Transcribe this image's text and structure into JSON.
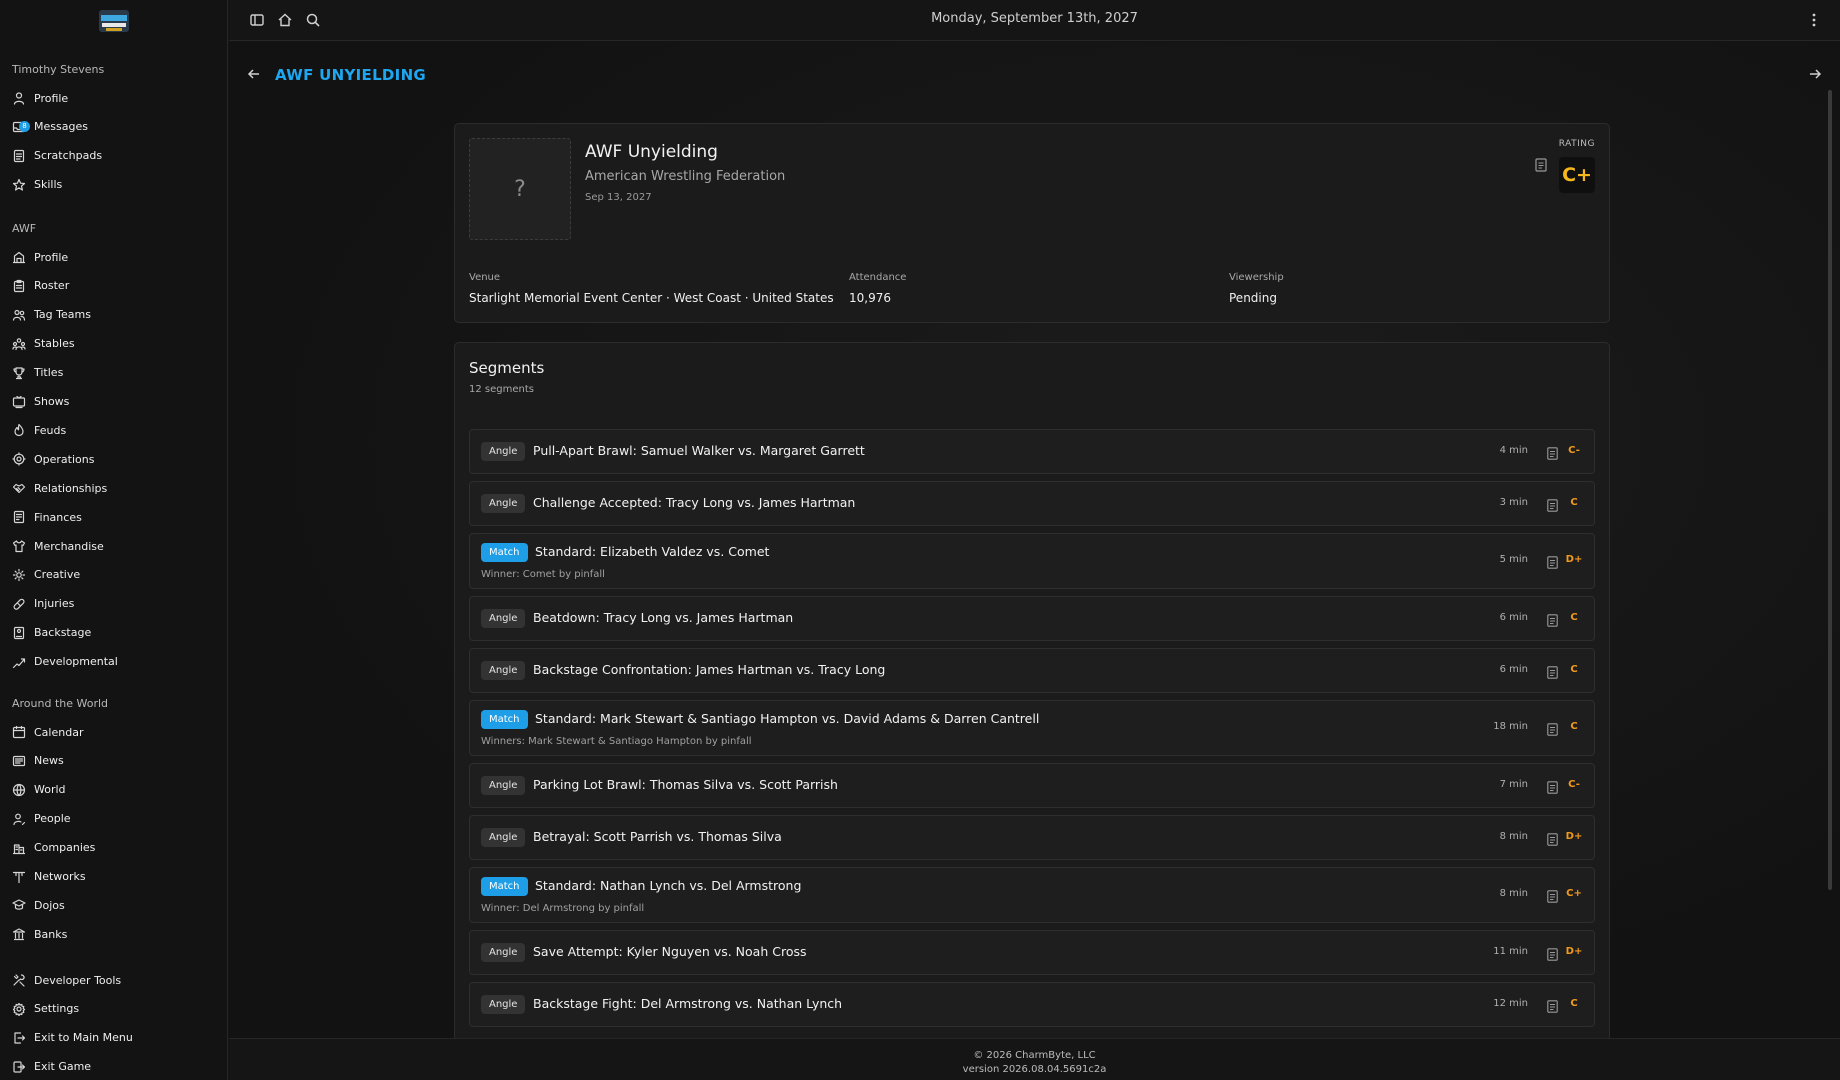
{
  "topbar": {
    "date": "Monday, September 13th, 2027"
  },
  "sidebar": {
    "user_section": "Timothy Stevens",
    "user_items": [
      {
        "label": "Profile",
        "icon": "user-icon"
      },
      {
        "label": "Messages",
        "icon": "inbox-icon",
        "badge": "8"
      },
      {
        "label": "Scratchpads",
        "icon": "notepad-icon"
      },
      {
        "label": "Skills",
        "icon": "star-icon"
      }
    ],
    "company_section": "AWF",
    "company_items": [
      {
        "label": "Profile",
        "icon": "building-icon"
      },
      {
        "label": "Roster",
        "icon": "clipboard-icon"
      },
      {
        "label": "Tag Teams",
        "icon": "users-icon"
      },
      {
        "label": "Stables",
        "icon": "group-icon"
      },
      {
        "label": "Titles",
        "icon": "trophy-icon"
      },
      {
        "label": "Shows",
        "icon": "tv-icon"
      },
      {
        "label": "Feuds",
        "icon": "flame-icon"
      },
      {
        "label": "Operations",
        "icon": "cog-icon"
      },
      {
        "label": "Relationships",
        "icon": "handshake-icon"
      },
      {
        "label": "Finances",
        "icon": "wallet-icon"
      },
      {
        "label": "Merchandise",
        "icon": "shirt-icon"
      },
      {
        "label": "Creative",
        "icon": "bulb-icon"
      },
      {
        "label": "Injuries",
        "icon": "bandage-icon"
      },
      {
        "label": "Backstage",
        "icon": "door-icon"
      },
      {
        "label": "Developmental",
        "icon": "growth-icon"
      }
    ],
    "world_section": "Around the World",
    "world_items": [
      {
        "label": "Calendar",
        "icon": "calendar-icon"
      },
      {
        "label": "News",
        "icon": "newspaper-icon"
      },
      {
        "label": "World",
        "icon": "globe-icon"
      },
      {
        "label": "People",
        "icon": "person-search-icon"
      },
      {
        "label": "Companies",
        "icon": "company-icon"
      },
      {
        "label": "Networks",
        "icon": "antenna-icon"
      },
      {
        "label": "Dojos",
        "icon": "school-icon"
      },
      {
        "label": "Banks",
        "icon": "bank-icon"
      }
    ],
    "bottom_items": [
      {
        "label": "Developer Tools",
        "icon": "tools-icon"
      },
      {
        "label": "Settings",
        "icon": "gear-icon"
      },
      {
        "label": "Exit to Main Menu",
        "icon": "exit-icon"
      },
      {
        "label": "Exit Game",
        "icon": "logout-icon"
      }
    ]
  },
  "page": {
    "title": "AWF UNYIELDING"
  },
  "show": {
    "poster_placeholder": "?",
    "name": "AWF Unyielding",
    "promotion": "American Wrestling Federation",
    "date": "Sep 13, 2027",
    "rating_label": "RATING",
    "rating": "C+",
    "venue_label": "Venue",
    "venue": "Starlight Memorial Event Center · West Coast · United States",
    "attendance_label": "Attendance",
    "attendance": "10,976",
    "viewership_label": "Viewership",
    "viewership": "Pending"
  },
  "segments": {
    "title": "Segments",
    "count": "12 segments",
    "items": [
      {
        "type": "Angle",
        "name": "Pull-Apart Brawl: Samuel Walker vs. Margaret Garrett",
        "duration": "4 min",
        "grade": "C-"
      },
      {
        "type": "Angle",
        "name": "Challenge Accepted: Tracy Long vs. James Hartman",
        "duration": "3 min",
        "grade": "C"
      },
      {
        "type": "Match",
        "name": "Standard: Elizabeth Valdez vs. Comet",
        "result": "Winner: Comet by pinfall",
        "duration": "5 min",
        "grade": "D+"
      },
      {
        "type": "Angle",
        "name": "Beatdown: Tracy Long vs. James Hartman",
        "duration": "6 min",
        "grade": "C"
      },
      {
        "type": "Angle",
        "name": "Backstage Confrontation: James Hartman vs. Tracy Long",
        "duration": "6 min",
        "grade": "C"
      },
      {
        "type": "Match",
        "name": "Standard: Mark Stewart & Santiago Hampton vs. David Adams & Darren Cantrell",
        "result": "Winners: Mark Stewart & Santiago Hampton by pinfall",
        "duration": "18 min",
        "grade": "C"
      },
      {
        "type": "Angle",
        "name": "Parking Lot Brawl: Thomas Silva vs. Scott Parrish",
        "duration": "7 min",
        "grade": "C-"
      },
      {
        "type": "Angle",
        "name": "Betrayal: Scott Parrish vs. Thomas Silva",
        "duration": "8 min",
        "grade": "D+"
      },
      {
        "type": "Match",
        "name": "Standard: Nathan Lynch vs. Del Armstrong",
        "result": "Winner: Del Armstrong by pinfall",
        "duration": "8 min",
        "grade": "C+"
      },
      {
        "type": "Angle",
        "name": "Save Attempt: Kyler Nguyen vs. Noah Cross",
        "duration": "11 min",
        "grade": "D+"
      },
      {
        "type": "Angle",
        "name": "Backstage Fight: Del Armstrong vs. Nathan Lynch",
        "duration": "12 min",
        "grade": "C"
      }
    ]
  },
  "footer": {
    "copyright": "© 2026 CharmByte, LLC",
    "version": "version 2026.08.04.5691c2a"
  },
  "colors": {
    "accent": "#1ea7f0",
    "rating": "#f5b81c",
    "grade": "#f29a1a",
    "match_tag": "#1e9ee6"
  }
}
